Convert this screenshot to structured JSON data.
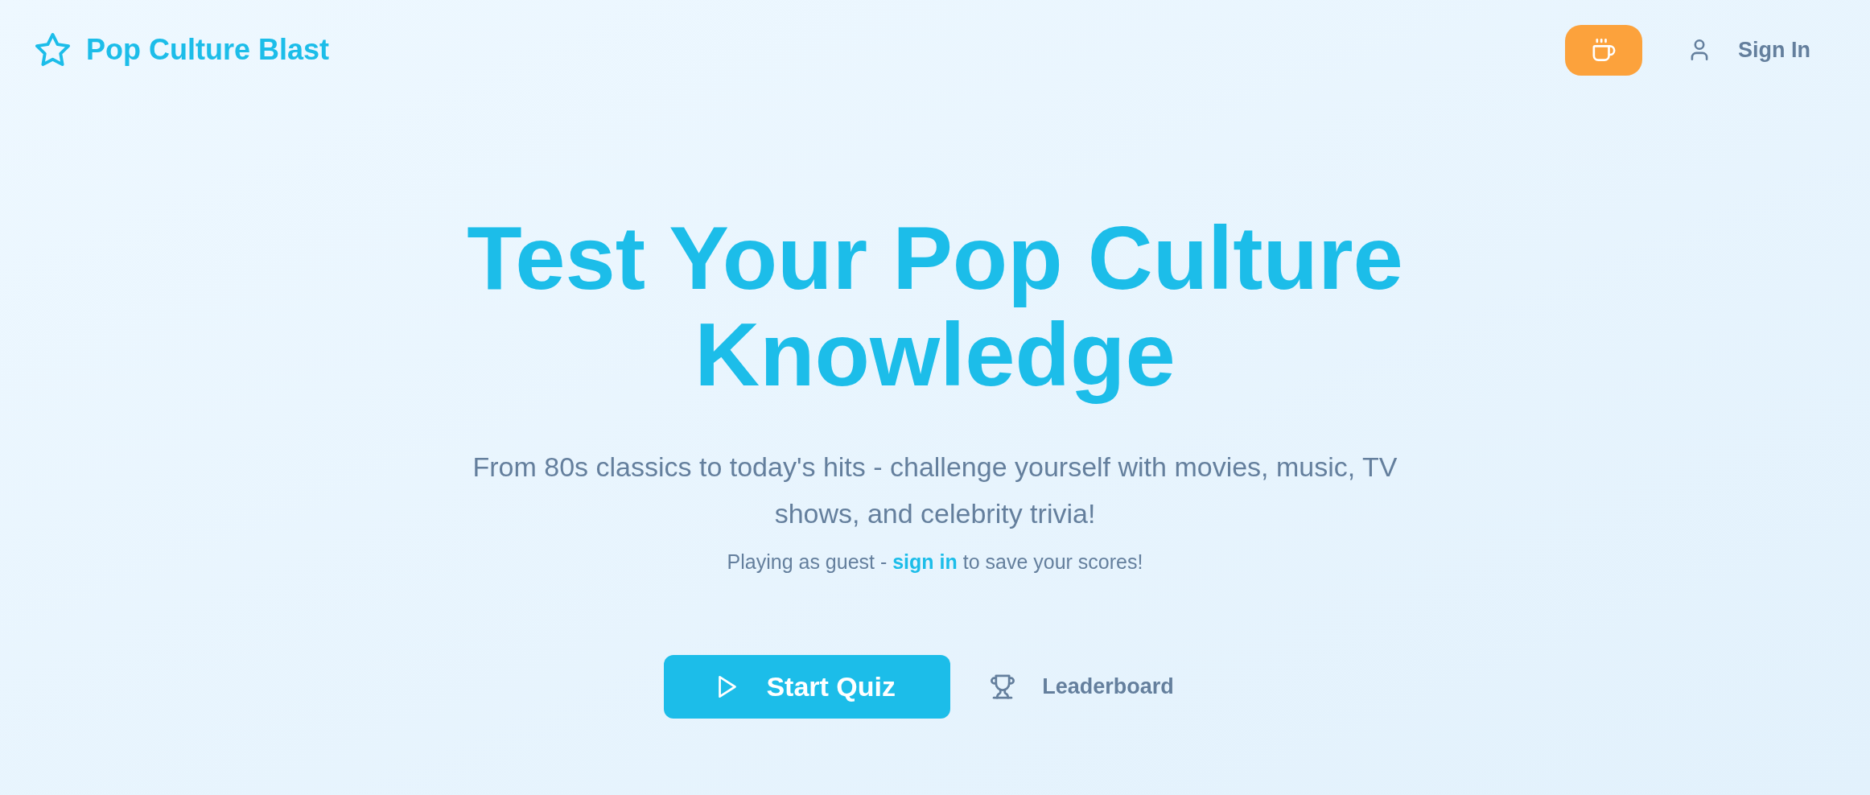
{
  "header": {
    "brand": "Pop Culture Blast",
    "sign_in": "Sign In"
  },
  "hero": {
    "title": "Test Your Pop Culture Knowledge",
    "subtitle": "From 80s classics to today's hits - challenge yourself with movies, music, TV shows, and celebrity trivia!",
    "guest_note": {
      "before": "Playing as guest -",
      "link": "sign in",
      "after": "to save your scores!"
    }
  },
  "actions": [
    {
      "kind": "primary",
      "label": "Start Quiz"
    },
    {
      "kind": "secondary",
      "label": "Leaderboard"
    }
  ]
}
